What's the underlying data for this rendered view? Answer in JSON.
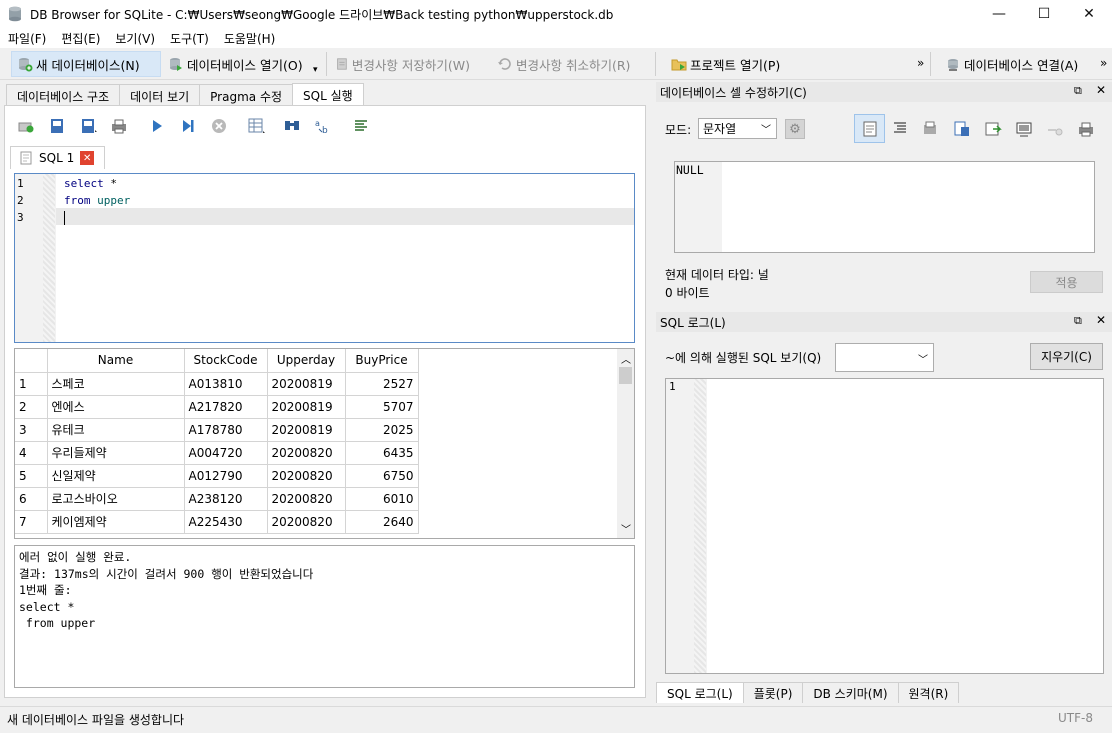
{
  "window": {
    "title": "DB Browser for SQLite - C:₩Users₩seong₩Google 드라이브₩Back testing python₩upperstock.db",
    "minimize": "—",
    "maximize": "☐",
    "close": "✕"
  },
  "menu": [
    "파일(F)",
    "편집(E)",
    "보기(V)",
    "도구(T)",
    "도움말(H)"
  ],
  "toolbar": {
    "new_db": "새 데이터베이스(N)",
    "open_db": "데이터베이스 열기(O)",
    "write_changes": "변경사항 저장하기(W)",
    "revert_changes": "변경사항 취소하기(R)",
    "open_project": "프로젝트 열기(P)",
    "attach_db": "데이터베이스 연결(A)",
    "overflow": "»"
  },
  "main_tabs": [
    "데이터베이스 구조",
    "데이터 보기",
    "Pragma 수정",
    "SQL 실행"
  ],
  "sql_tab": {
    "label": "SQL 1"
  },
  "editor": {
    "line_numbers": [
      "1",
      "2",
      "3"
    ],
    "lines": [
      {
        "kw": "select",
        "rest": " *"
      },
      {
        "kw": "from",
        "rest": " upper"
      },
      {
        "kw": "",
        "rest": ""
      }
    ]
  },
  "results": {
    "columns": [
      "Name",
      "StockCode",
      "Upperday",
      "BuyPrice"
    ],
    "rows": [
      {
        "n": "1",
        "name": "스페코",
        "code": "A013810",
        "day": "20200819",
        "price": "2527"
      },
      {
        "n": "2",
        "name": "엔에스",
        "code": "A217820",
        "day": "20200819",
        "price": "5707"
      },
      {
        "n": "3",
        "name": "유테크",
        "code": "A178780",
        "day": "20200819",
        "price": "2025"
      },
      {
        "n": "4",
        "name": "우리들제약",
        "code": "A004720",
        "day": "20200820",
        "price": "6435"
      },
      {
        "n": "5",
        "name": "신일제약",
        "code": "A012790",
        "day": "20200820",
        "price": "6750"
      },
      {
        "n": "6",
        "name": "로고스바이오",
        "code": "A238120",
        "day": "20200820",
        "price": "6010"
      },
      {
        "n": "7",
        "name": "케이엠제약",
        "code": "A225430",
        "day": "20200820",
        "price": "2640"
      }
    ]
  },
  "message": {
    "line1": "에러 없이 실행 완료.",
    "line2_prefix": "결과: ",
    "time": "137ms",
    "line2_mid": "의 시간이 걸려서 ",
    "count": "900",
    "line2_suffix": " 행이 반환되었습니다",
    "line3": "1번째 줄:",
    "line4": "select *",
    "line5": " from upper"
  },
  "edit_cell": {
    "title": "데이터베이스 셀 수정하기(C)",
    "mode_label": "모드:",
    "mode_value": "문자열",
    "cell_value": "NULL",
    "type_label": "현재 데이터 타입: 널",
    "size_label": "0 바이트",
    "apply": "적용"
  },
  "sql_log": {
    "title": "SQL 로그(L)",
    "submitted_label": "~에 의해 실행된 SQL 보기(Q)",
    "clear": "지우기(C)",
    "line": "1"
  },
  "bottom_tabs": [
    "SQL 로그(L)",
    "플롯(P)",
    "DB 스키마(M)",
    "원격(R)"
  ],
  "status": {
    "text": "새 데이터베이스 파일을 생성합니다",
    "encoding": "UTF-8"
  },
  "colors": {
    "keyword": "#000080",
    "identifier": "#006060",
    "accent": "#d9e8f7",
    "close_red": "#e0432f"
  }
}
